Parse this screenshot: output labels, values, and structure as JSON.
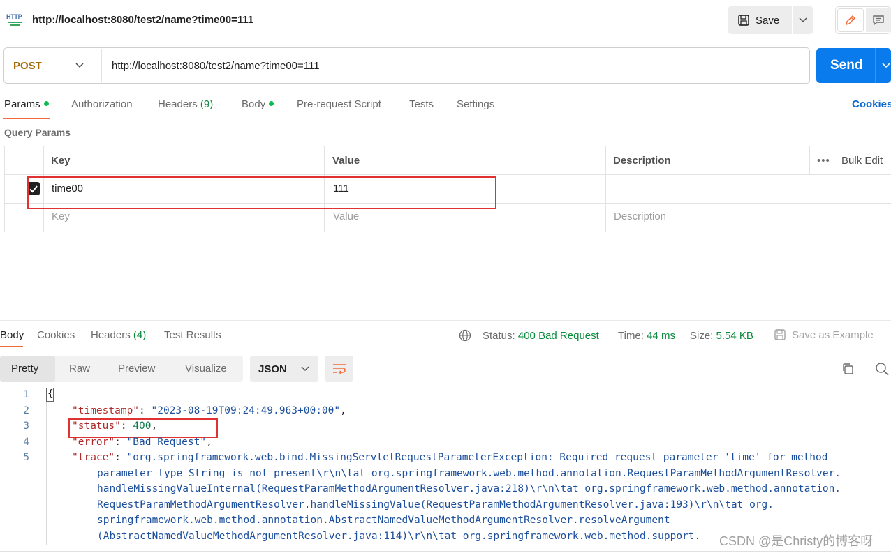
{
  "request": {
    "title": "http://localhost:8080/test2/name?time00=111",
    "icon_label": "HTTP",
    "save_label": "Save",
    "method": "POST",
    "url": "http://localhost:8080/test2/name?time00=111",
    "send_label": "Send"
  },
  "request_tabs": [
    {
      "label": "Params",
      "dot": true
    },
    {
      "label": "Authorization"
    },
    {
      "label": "Headers",
      "count": "(9)"
    },
    {
      "label": "Body",
      "dot": true
    },
    {
      "label": "Pre-request Script"
    },
    {
      "label": "Tests"
    },
    {
      "label": "Settings"
    }
  ],
  "cookies_label": "Cookies",
  "query_params": {
    "title": "Query Params",
    "headers": {
      "key": "Key",
      "value": "Value",
      "description": "Description",
      "bulk_edit": "Bulk Edit",
      "more": "•••"
    },
    "rows": [
      {
        "checked": true,
        "key": "time00",
        "value": "111",
        "description": ""
      }
    ],
    "placeholder": {
      "key": "Key",
      "value": "Value",
      "description": "Description"
    }
  },
  "response": {
    "tabs": [
      {
        "label": "Body"
      },
      {
        "label": "Cookies"
      },
      {
        "label": "Headers",
        "count": "(4)"
      },
      {
        "label": "Test Results"
      }
    ],
    "status_label": "Status:",
    "status_value": "400 Bad Request",
    "time_label": "Time:",
    "time_value": "44 ms",
    "size_label": "Size:",
    "size_value": "5.54 KB",
    "save_example_label": "Save as Example",
    "view_tabs": [
      "Pretty",
      "Raw",
      "Preview",
      "Visualize"
    ],
    "format": "JSON",
    "line_numbers": [
      "1",
      "2",
      "3",
      "4",
      "5"
    ],
    "body": {
      "open_brace": "{",
      "timestamp_key": "\"timestamp\"",
      "timestamp_value": "\"2023-08-19T09:24:49.963+00:00\"",
      "status_key": "\"status\"",
      "status_value": "400",
      "error_key": "\"error\"",
      "error_value": "\"Bad Request\"",
      "trace_key": "\"trace\"",
      "trace_lines": [
        "\"org.springframework.web.bind.MissingServletRequestParameterException: Required request parameter 'time' for method",
        "parameter type String is not present\\r\\n\\tat org.springframework.web.method.annotation.RequestParamMethodArgumentResolver.",
        "handleMissingValueInternal(RequestParamMethodArgumentResolver.java:218)\\r\\n\\tat org.springframework.web.method.annotation.",
        "RequestParamMethodArgumentResolver.handleMissingValue(RequestParamMethodArgumentResolver.java:193)\\r\\n\\tat org.",
        "springframework.web.method.annotation.AbstractNamedValueMethodArgumentResolver.resolveArgument",
        "(AbstractNamedValueMethodArgumentResolver.java:114)\\r\\n\\tat org.springframework.web.method.support."
      ]
    }
  },
  "watermark": "CSDN @是Christy的博客呀",
  "colors": {
    "accent": "#f26b3a",
    "send": "#097bed",
    "method": "#a56b0b",
    "status_ok_green": "#0a8a3c",
    "highlight_red": "#e03232"
  }
}
